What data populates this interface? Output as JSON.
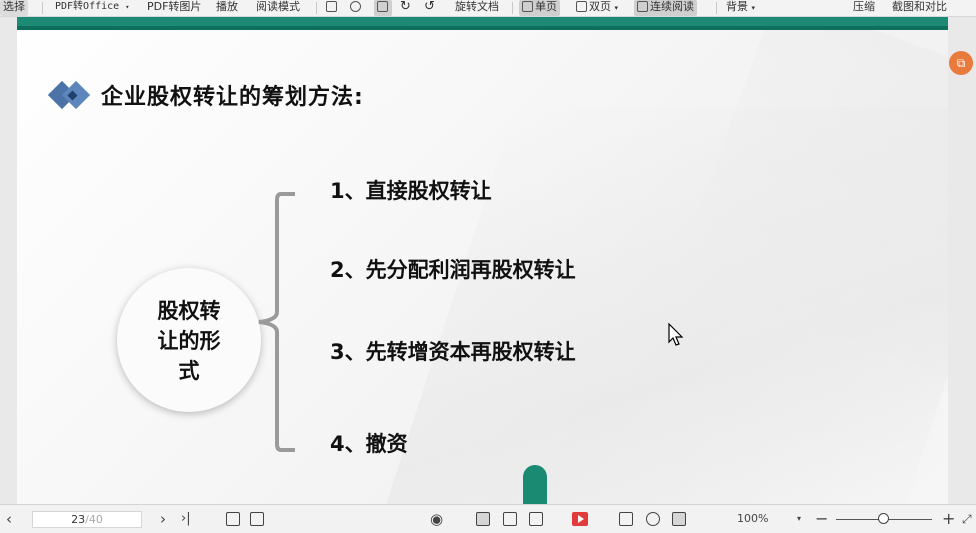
{
  "toolbar": {
    "select": "选择",
    "pdf_to_office": "PDF转Office",
    "pdf_to_image": "PDF转图片",
    "play": "播放",
    "read_mode": "阅读模式",
    "rotate_doc": "旋转文档",
    "single_page": "单页",
    "double_page": "双页",
    "continuous": "连续阅读",
    "background": "背景",
    "compress": "压缩",
    "screenshot_compare": "截图和对比"
  },
  "slide": {
    "title": "企业股权转让的筹划方法:",
    "circle_text": "股权转\n让的形\n式",
    "items": [
      "1、直接股权转让",
      "2、先分配利润再股权转让",
      "3、先转增资本再股权转让",
      "4、撤资"
    ]
  },
  "status": {
    "page_current": "23",
    "page_total": "/40",
    "zoom": "100%"
  },
  "colors": {
    "teal": "#1c8a74",
    "accent_orange": "#e87a3d",
    "diamond_blue": "#4b73a8",
    "play_red": "#e23b3b"
  }
}
